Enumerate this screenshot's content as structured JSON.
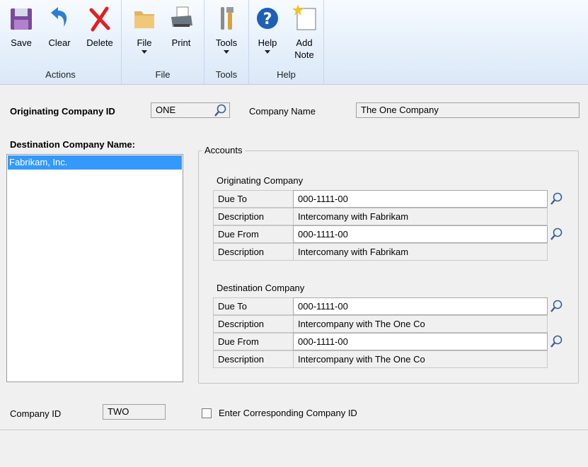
{
  "ribbon": {
    "actions": {
      "label": "Actions",
      "save": "Save",
      "clear": "Clear",
      "delete": "Delete"
    },
    "file": {
      "label": "File",
      "file": "File",
      "print": "Print"
    },
    "tools": {
      "label": "Tools",
      "tools": "Tools"
    },
    "help": {
      "label": "Help",
      "help": "Help",
      "add_note": "Add\nNote"
    }
  },
  "originating": {
    "label": "Originating Company ID",
    "value": "ONE",
    "company_name_label": "Company Name",
    "company_name": "The One Company"
  },
  "destination": {
    "label": "Destination Company Name:",
    "items": [
      "Fabrikam, Inc."
    ]
  },
  "accounts": {
    "title": "Accounts",
    "orig_section": "Originating Company",
    "dest_section": "Destination Company",
    "rows": [
      {
        "label": "Due To",
        "value": "000-1111-00"
      },
      {
        "label": "Description",
        "value": "Intercomany with Fabrikam"
      },
      {
        "label": "Due From",
        "value": "000-1111-00"
      },
      {
        "label": "Description",
        "value": "Intercomany with Fabrikam"
      },
      {
        "label": "Due To",
        "value": "000-1111-00"
      },
      {
        "label": "Description",
        "value": "Intercompany with The One Co"
      },
      {
        "label": "Due From",
        "value": "000-1111-00"
      },
      {
        "label": "Description",
        "value": "Intercompany with The One Co"
      }
    ]
  },
  "footer": {
    "company_id_label": "Company ID",
    "company_id": "TWO",
    "checkbox_label": "Enter Corresponding Company ID"
  }
}
